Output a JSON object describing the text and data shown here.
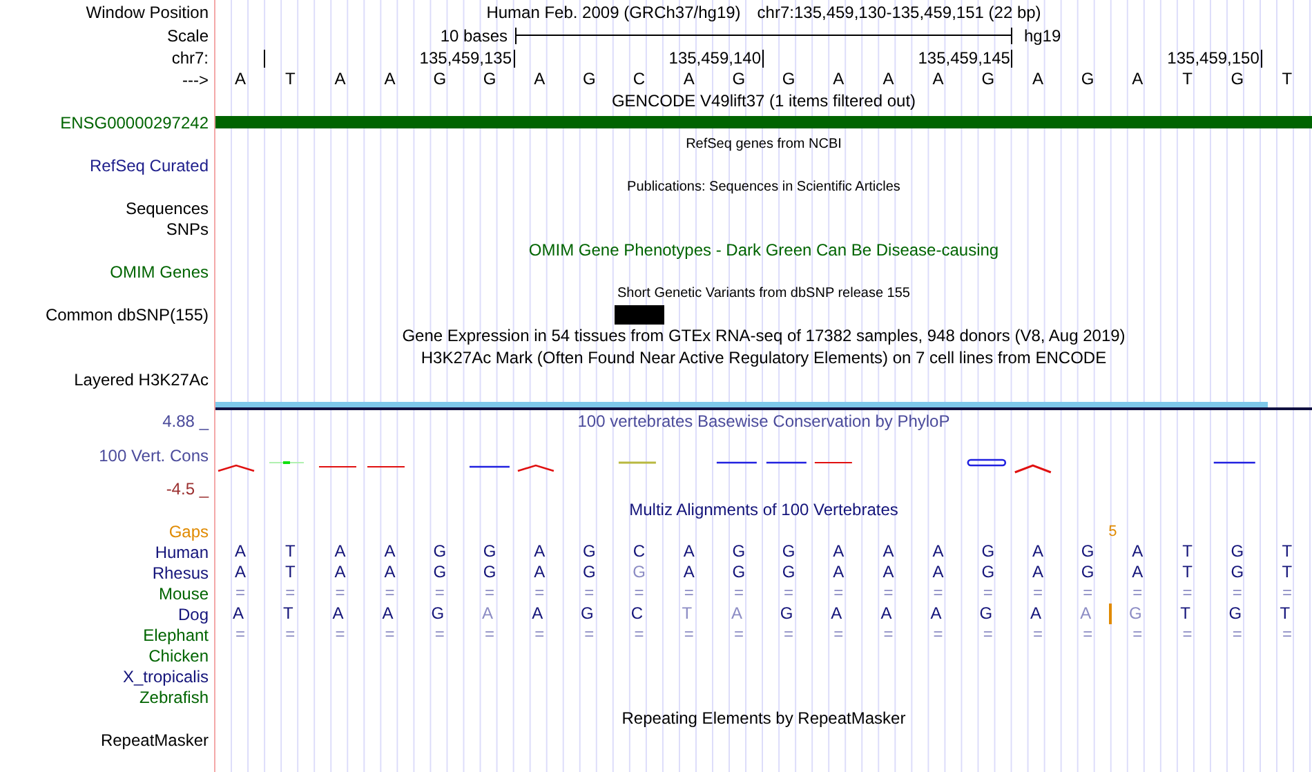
{
  "header": {
    "window_label": "Window Position",
    "assembly": "Human Feb. 2009 (GRCh37/hg19)",
    "position": "chr7:135,459,130-135,459,151 (22 bp)",
    "scale_label": "Scale",
    "scale_text": "10 bases",
    "scale_assembly": "hg19",
    "chrom_label": "chr7:",
    "ticks": [
      "135,459,135",
      "135,459,140",
      "135,459,145",
      "135,459,150"
    ],
    "strand_label": "--->",
    "bases": [
      "A",
      "T",
      "A",
      "A",
      "G",
      "G",
      "A",
      "G",
      "C",
      "A",
      "G",
      "G",
      "A",
      "A",
      "A",
      "G",
      "A",
      "G",
      "A",
      "T",
      "G",
      "T"
    ]
  },
  "tracks": [
    {
      "kind": "bar",
      "title": "GENCODE V49lift37 (1 items filtered out)",
      "title_colored": false,
      "labels": [
        "ENSG00000297242"
      ],
      "color": "#006400"
    },
    {
      "kind": "compact",
      "title": "RefSeq genes from NCBI",
      "title_colored": false,
      "labels": [
        "RefSeq Curated"
      ],
      "color": "#20208c"
    },
    {
      "kind": "compact",
      "title": "Publications: Sequences in Scientific Articles",
      "title_colored": false,
      "labels": [
        "Sequences",
        "SNPs"
      ],
      "color": "#000000"
    },
    {
      "kind": "text",
      "title": "OMIM Gene Phenotypes - Dark Green Can Be Disease-causing",
      "title_colored": true,
      "labels": [
        "OMIM Genes"
      ],
      "color": "#006400"
    },
    {
      "kind": "snp",
      "title": "Short Genetic Variants from dbSNP release 155",
      "title_colored": false,
      "labels": [
        "Common dbSNP(155)"
      ],
      "color": "#000000"
    },
    {
      "kind": "text",
      "title": "Gene Expression in 54 tissues from GTEx RNA-seq of 17382 samples, 948 donors (V8, Aug 2019)"
    },
    {
      "kind": "layered",
      "title": "H3K27Ac Mark (Often Found Near Active Regulatory Elements) on 7 cell lines from ENCODE",
      "title_colored": false,
      "labels": [
        "Layered H3K27Ac"
      ],
      "color": "#000000"
    },
    {
      "kind": "wiggle",
      "title": "100 vertebrates Basewise Conservation by PhyloP",
      "title_colored": true,
      "labels": [
        "100 Vert. Cons"
      ],
      "color": "#4b4b9b",
      "max_label": "4.88 _",
      "min_label": "-4.5 _"
    },
    {
      "kind": "alignment",
      "title": "Multiz Alignments of 100 Vertebrates",
      "title_colored": true,
      "color": "#14147a",
      "gaps": {
        "label": "Gaps",
        "count": "5",
        "color": "#e08a00"
      },
      "species": [
        {
          "name": "Human",
          "color": "#14147a",
          "cells": [
            {
              "base": "A",
              "dimmed": false
            },
            {
              "base": "T",
              "dimmed": false
            },
            {
              "base": "A",
              "dimmed": false
            },
            {
              "base": "A",
              "dimmed": false
            },
            {
              "base": "G",
              "dimmed": false
            },
            {
              "base": "G",
              "dimmed": false
            },
            {
              "base": "A",
              "dimmed": false
            },
            {
              "base": "G",
              "dimmed": false
            },
            {
              "base": "C",
              "dimmed": false
            },
            {
              "base": "A",
              "dimmed": false
            },
            {
              "base": "G",
              "dimmed": false
            },
            {
              "base": "G",
              "dimmed": false
            },
            {
              "base": "A",
              "dimmed": false
            },
            {
              "base": "A",
              "dimmed": false
            },
            {
              "base": "A",
              "dimmed": false
            },
            {
              "base": "G",
              "dimmed": false
            },
            {
              "base": "A",
              "dimmed": false
            },
            {
              "base": "G",
              "dimmed": false
            },
            {
              "base": "A",
              "dimmed": false
            },
            {
              "base": "T",
              "dimmed": false
            },
            {
              "base": "G",
              "dimmed": false
            },
            {
              "base": "T",
              "dimmed": false
            }
          ]
        },
        {
          "name": "Rhesus",
          "color": "#14147a",
          "cells": [
            {
              "base": "A",
              "dimmed": false
            },
            {
              "base": "T",
              "dimmed": false
            },
            {
              "base": "A",
              "dimmed": false
            },
            {
              "base": "A",
              "dimmed": false
            },
            {
              "base": "G",
              "dimmed": false
            },
            {
              "base": "G",
              "dimmed": false
            },
            {
              "base": "A",
              "dimmed": false
            },
            {
              "base": "G",
              "dimmed": false
            },
            {
              "base": "G",
              "dimmed": true
            },
            {
              "base": "A",
              "dimmed": false
            },
            {
              "base": "G",
              "dimmed": false
            },
            {
              "base": "G",
              "dimmed": false
            },
            {
              "base": "A",
              "dimmed": false
            },
            {
              "base": "A",
              "dimmed": false
            },
            {
              "base": "A",
              "dimmed": false
            },
            {
              "base": "G",
              "dimmed": false
            },
            {
              "base": "A",
              "dimmed": false
            },
            {
              "base": "G",
              "dimmed": false
            },
            {
              "base": "A",
              "dimmed": false
            },
            {
              "base": "T",
              "dimmed": false
            },
            {
              "base": "G",
              "dimmed": false
            },
            {
              "base": "T",
              "dimmed": false
            }
          ]
        },
        {
          "name": "Mouse",
          "color": "#006400",
          "cells": [
            {
              "base": "=",
              "dimmed": true
            },
            {
              "base": "=",
              "dimmed": true
            },
            {
              "base": "=",
              "dimmed": true
            },
            {
              "base": "=",
              "dimmed": true
            },
            {
              "base": "=",
              "dimmed": true
            },
            {
              "base": "=",
              "dimmed": true
            },
            {
              "base": "=",
              "dimmed": true
            },
            {
              "base": "=",
              "dimmed": true
            },
            {
              "base": "=",
              "dimmed": true
            },
            {
              "base": "=",
              "dimmed": true
            },
            {
              "base": "=",
              "dimmed": true
            },
            {
              "base": "=",
              "dimmed": true
            },
            {
              "base": "=",
              "dimmed": true
            },
            {
              "base": "=",
              "dimmed": true
            },
            {
              "base": "=",
              "dimmed": true
            },
            {
              "base": "=",
              "dimmed": true
            },
            {
              "base": "=",
              "dimmed": true
            },
            {
              "base": "=",
              "dimmed": true
            },
            {
              "base": "=",
              "dimmed": true
            },
            {
              "base": "=",
              "dimmed": true
            },
            {
              "base": "=",
              "dimmed": true
            },
            {
              "base": "=",
              "dimmed": true
            }
          ]
        },
        {
          "name": "Dog",
          "color": "#14147a",
          "cells": [
            {
              "base": "A",
              "dimmed": false,
              "insertion": false
            },
            {
              "base": "T",
              "dimmed": false,
              "insertion": false
            },
            {
              "base": "A",
              "dimmed": false,
              "insertion": false
            },
            {
              "base": "A",
              "dimmed": false,
              "insertion": false
            },
            {
              "base": "G",
              "dimmed": false,
              "insertion": false
            },
            {
              "base": "A",
              "dimmed": true,
              "insertion": false
            },
            {
              "base": "A",
              "dimmed": false,
              "insertion": false
            },
            {
              "base": "G",
              "dimmed": false,
              "insertion": false
            },
            {
              "base": "C",
              "dimmed": false,
              "insertion": false
            },
            {
              "base": "T",
              "dimmed": true,
              "insertion": false
            },
            {
              "base": "A",
              "dimmed": true,
              "insertion": false
            },
            {
              "base": "G",
              "dimmed": false,
              "insertion": false
            },
            {
              "base": "A",
              "dimmed": false,
              "insertion": false
            },
            {
              "base": "A",
              "dimmed": false,
              "insertion": false
            },
            {
              "base": "A",
              "dimmed": false,
              "insertion": false
            },
            {
              "base": "G",
              "dimmed": false,
              "insertion": false
            },
            {
              "base": "A",
              "dimmed": false,
              "insertion": false
            },
            {
              "base": "A",
              "dimmed": true,
              "insertion": true
            },
            {
              "base": "G",
              "dimmed": true,
              "insertion": false
            },
            {
              "base": "T",
              "dimmed": false,
              "insertion": false
            },
            {
              "base": "G",
              "dimmed": false,
              "insertion": false
            },
            {
              "base": "T",
              "dimmed": false,
              "insertion": false
            }
          ]
        },
        {
          "name": "Elephant",
          "color": "#006400",
          "cells": [
            {
              "base": "=",
              "dimmed": true
            },
            {
              "base": "=",
              "dimmed": true
            },
            {
              "base": "=",
              "dimmed": true
            },
            {
              "base": "=",
              "dimmed": true
            },
            {
              "base": "=",
              "dimmed": true
            },
            {
              "base": "=",
              "dimmed": true
            },
            {
              "base": "=",
              "dimmed": true
            },
            {
              "base": "=",
              "dimmed": true
            },
            {
              "base": "=",
              "dimmed": true
            },
            {
              "base": "=",
              "dimmed": true
            },
            {
              "base": "=",
              "dimmed": true
            },
            {
              "base": "=",
              "dimmed": true
            },
            {
              "base": "=",
              "dimmed": true
            },
            {
              "base": "=",
              "dimmed": true
            },
            {
              "base": "=",
              "dimmed": true
            },
            {
              "base": "=",
              "dimmed": true
            },
            {
              "base": "=",
              "dimmed": true
            },
            {
              "base": "=",
              "dimmed": true
            },
            {
              "base": "=",
              "dimmed": true
            },
            {
              "base": "=",
              "dimmed": true
            },
            {
              "base": "=",
              "dimmed": true
            },
            {
              "base": "=",
              "dimmed": true
            }
          ]
        },
        {
          "name": "Chicken",
          "color": "#006400"
        },
        {
          "name": "X_tropicalis",
          "color": "#14147a"
        },
        {
          "name": "Zebrafish",
          "color": "#006400"
        }
      ]
    },
    {
      "kind": "text",
      "title": "Repeating Elements by RepeatMasker",
      "title_colored": false,
      "labels": [
        "RepeatMasker"
      ],
      "color": "#000000"
    }
  ]
}
